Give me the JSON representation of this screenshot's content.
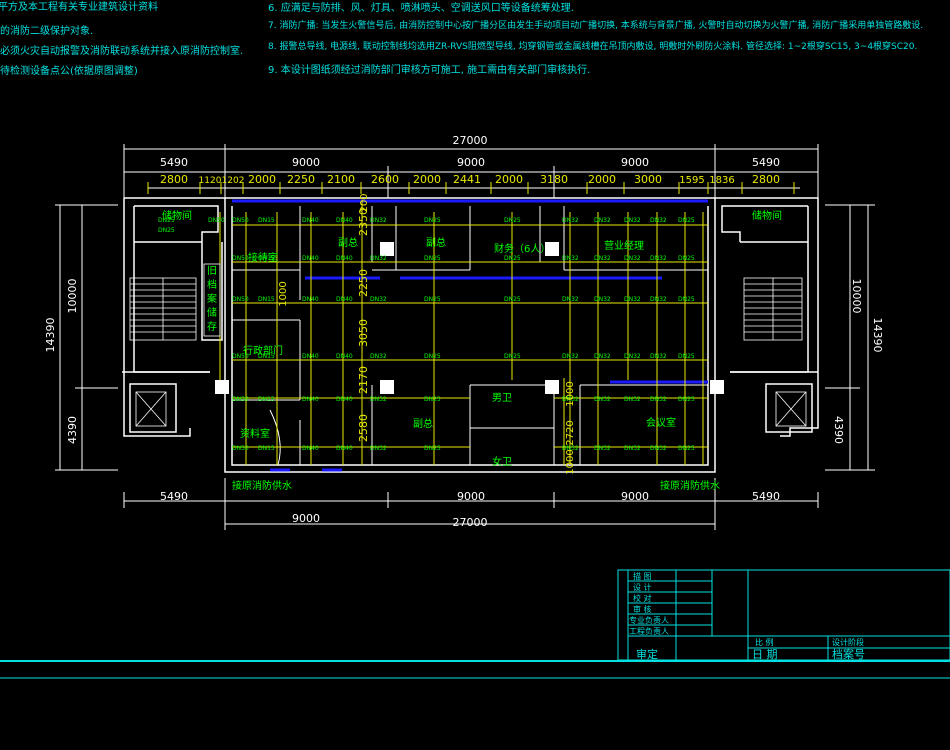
{
  "notes_left": [
    "平方及本工程有关专业建筑设计资料",
    "的消防二级保护对象.",
    "必须火灾自动报警及消防联动系统并接入原消防控制室.",
    "待检测设备点公(依据原图调整)"
  ],
  "notes_right": [
    "6. 应满足与防排、风、灯具、喷淋喷头、空调送风口等设备统筹处理.",
    "7. 消防广播: 当发生火警信号后, 由消防控制中心按广播分区由发生手动项目动广播切换, 本系统与背景广播, 火警时自动切换为火警广播, 消防广播采用单独管路敷设.",
    "8. 报警总导线, 电源线, 联动控制线均选用ZR-RVS阻燃型导线, 均穿钢管或金属线槽在吊顶内敷设, 明敷时外刷防火涂料. 管径选择: 1~2根穿SC15, 3~4根穿SC20.",
    "9. 本设计图纸须经过消防部门审核方可施工, 施工需由有关部门审核执行."
  ],
  "dimensions": {
    "total_top": "27000",
    "top_mid": [
      "5490",
      "9000",
      "9000",
      "9000",
      "5490"
    ],
    "top_fine": [
      "2800",
      "1120",
      "1202",
      "2000",
      "2250",
      "2100",
      "2600",
      "2000",
      "2441",
      "2000",
      "3180",
      "2000",
      "3000",
      "1595",
      "1836",
      "2800"
    ],
    "left_total": "14390",
    "left_parts": [
      "10000",
      "4390"
    ],
    "right_total": "14390",
    "right_parts": [
      "10000",
      "4390"
    ],
    "interior_vertical": [
      "2350",
      "2250",
      "3050",
      "2170",
      "2580"
    ],
    "interior_vertical_right": [
      "1000",
      "2720",
      "1000"
    ],
    "bottom_mid": [
      "5490",
      "9000",
      "9000",
      "5490"
    ],
    "bottom_9000": "9000",
    "total_bottom": "27000",
    "top_200": "200"
  },
  "rooms": {
    "storage_left": "储物间",
    "storage_right": "储物间",
    "reception": "接待室",
    "deputy_gm": "副总",
    "general_manager": "副总",
    "finance": "财务（6人）",
    "office_large": "营业经理",
    "archive": "旧档案储存",
    "admin_dept": "行政部门",
    "data_room": "资料室",
    "manager": "副总",
    "men_wc": "男卫",
    "women_wc": "女卫",
    "meeting": "会议室",
    "hydrant_left": "接原消防供水",
    "hydrant_right": "接原消防供水"
  },
  "device_labels": {
    "dn25": "DN25",
    "dn32": "DN32",
    "dn40": "DN40",
    "dn50": "DN50",
    "dn15": "DN15"
  },
  "title_block": {
    "rows": [
      "描 图",
      "设 计",
      "校 对",
      "审 核",
      "专业负责人",
      "工程负责人"
    ],
    "scale_label": "比 例",
    "stage_label": "设计阶段",
    "approve_label": "审定",
    "date_label": "日 期",
    "archive_label": "档案号"
  },
  "colors": {
    "background": "#000000",
    "wall": "#ffffff",
    "pipe": "#e8e800",
    "label": "#00ff00",
    "note": "#00e0e0",
    "sprinkler_main": "#1a1aff"
  }
}
